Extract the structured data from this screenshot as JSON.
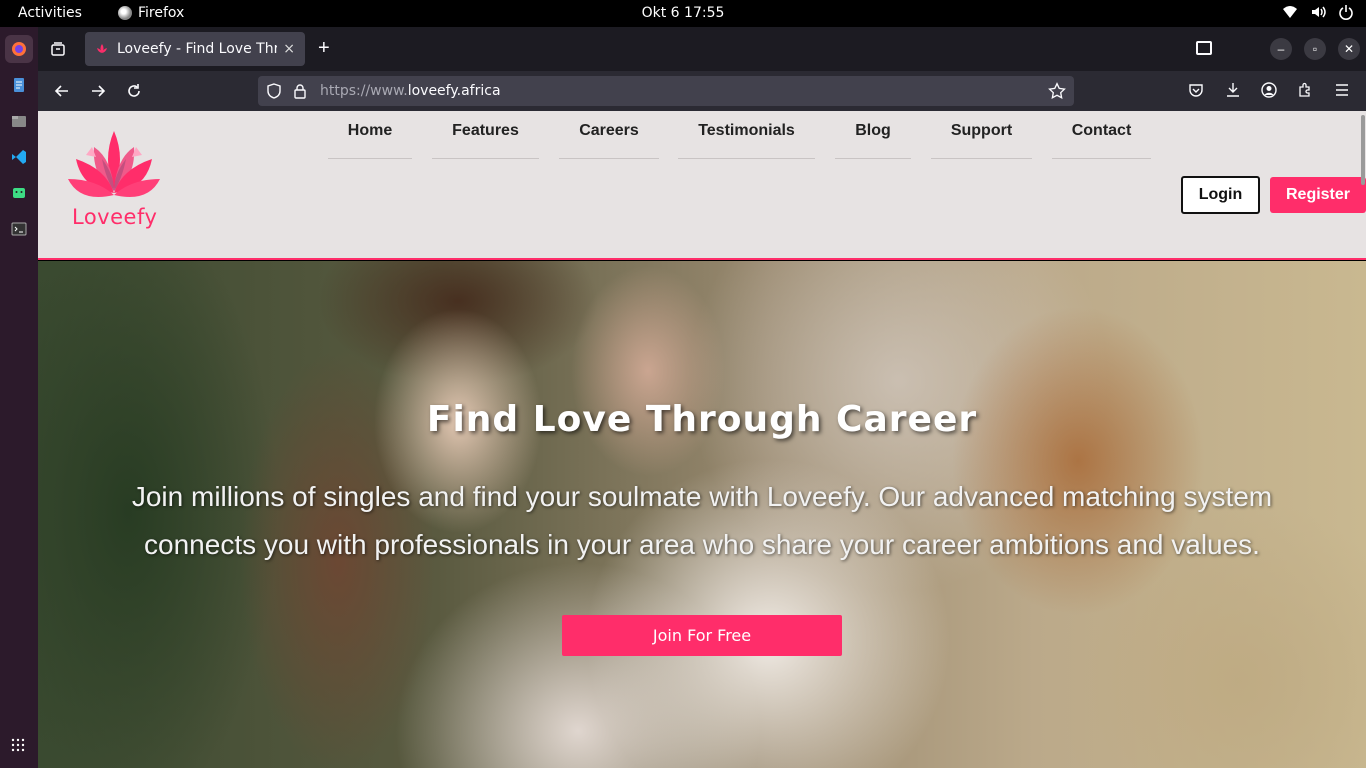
{
  "topbar": {
    "activities": "Activities",
    "app_name": "Firefox",
    "clock": "Okt 6  17:55"
  },
  "dock": {
    "items": [
      "firefox-icon",
      "text-editor-icon",
      "files-icon",
      "vscode-icon",
      "android-icon",
      "terminal-icon"
    ],
    "apps_grid": "show-applications-icon"
  },
  "browser": {
    "tab_title": "Loveefy - Find Love Through Career",
    "new_tab": "+",
    "close_tab": "×",
    "url_prefix": "https://www.",
    "url_domain": "loveefy.africa"
  },
  "site": {
    "brand": "Loveefy",
    "brand_color": "#ff2d6a",
    "nav": [
      {
        "label": "Home"
      },
      {
        "label": "Features"
      },
      {
        "label": "Careers"
      },
      {
        "label": "Testimonials"
      },
      {
        "label": "Blog"
      },
      {
        "label": "Support"
      },
      {
        "label": "Contact"
      }
    ],
    "login_label": "Login",
    "register_label": "Register"
  },
  "hero": {
    "title": "Find Love Through Career",
    "text": "Join millions of singles and find your soulmate with Loveefy. Our advanced matching system connects you with professionals in your area who share your career ambitions and values.",
    "cta_label": "Join For Free"
  }
}
